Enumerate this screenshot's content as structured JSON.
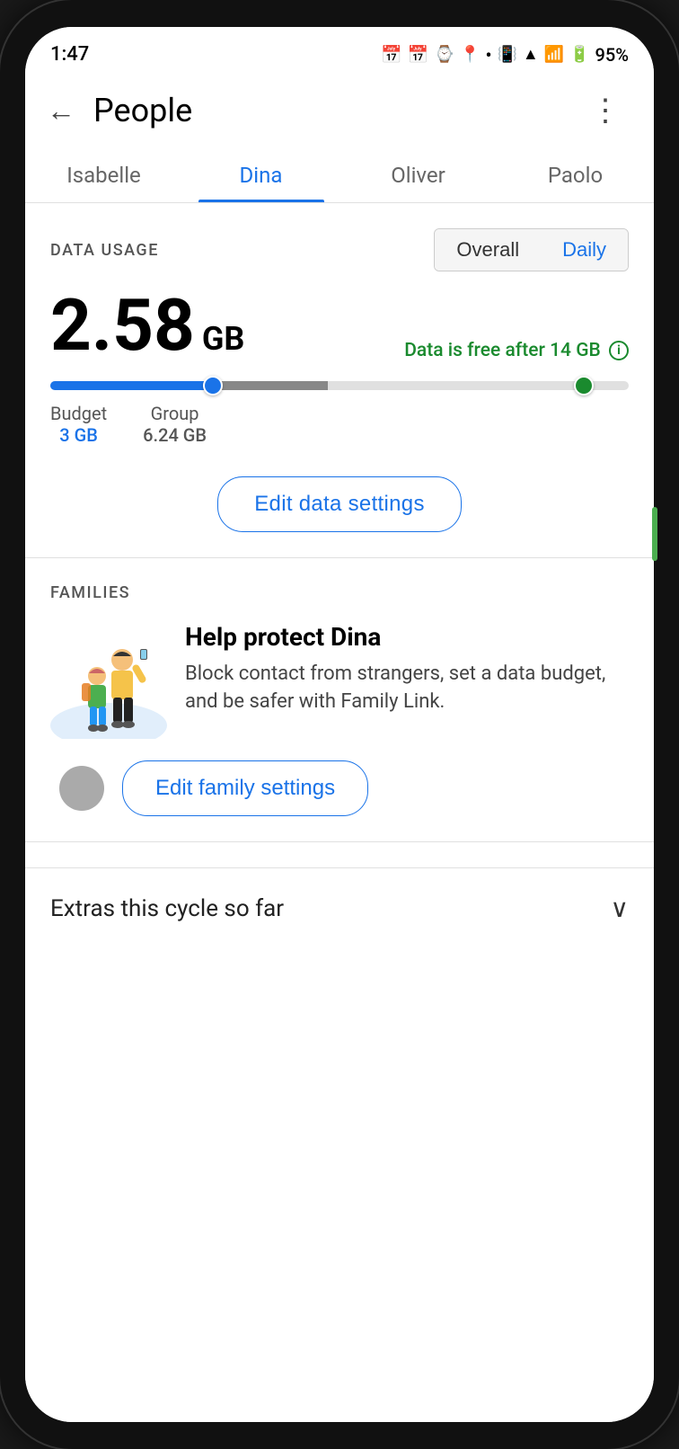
{
  "statusBar": {
    "time": "1:47",
    "battery": "95%",
    "icons": [
      "calendar1",
      "calendar2",
      "voicemail",
      "location",
      "dot",
      "vibrate",
      "wifi",
      "signal",
      "battery"
    ]
  },
  "toolbar": {
    "title": "People",
    "backLabel": "←",
    "moreLabel": "⋮"
  },
  "tabs": [
    {
      "label": "Isabelle",
      "active": false
    },
    {
      "label": "Dina",
      "active": true
    },
    {
      "label": "Oliver",
      "active": false
    },
    {
      "label": "Paolo",
      "active": false
    }
  ],
  "dataUsage": {
    "sectionLabel": "DATA USAGE",
    "toggleOverall": "Overall",
    "toggleDaily": "Daily",
    "usedAmount": "2.58",
    "usedUnit": "GB",
    "freeDataNote": "Data is free after 14 GB",
    "budgetLabel": "Budget",
    "budgetValue": "3 GB",
    "groupLabel": "Group",
    "groupValue": "6.24 GB",
    "editButton": "Edit data settings"
  },
  "families": {
    "sectionLabel": "FAMILIES",
    "heading": "Help protect Dina",
    "description": "Block contact from strangers, set a data budget, and be safer with Family Link.",
    "editButton": "Edit family settings"
  },
  "extras": {
    "label": "Extras this cycle so far"
  }
}
